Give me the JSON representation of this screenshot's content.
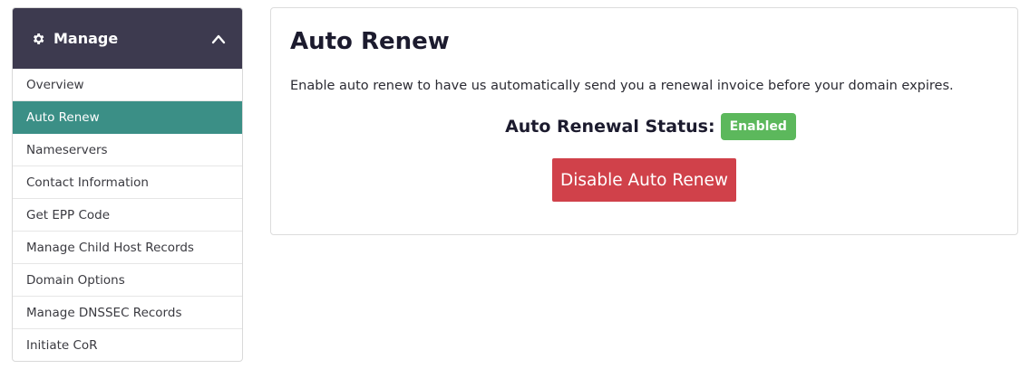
{
  "sidebar": {
    "header": {
      "title": "Manage",
      "icon": "gear-icon",
      "toggle_icon": "chevron-up-icon"
    },
    "items": [
      {
        "label": "Overview",
        "active": false
      },
      {
        "label": "Auto Renew",
        "active": true
      },
      {
        "label": "Nameservers",
        "active": false
      },
      {
        "label": "Contact Information",
        "active": false
      },
      {
        "label": "Get EPP Code",
        "active": false
      },
      {
        "label": "Manage Child Host Records",
        "active": false
      },
      {
        "label": "Domain Options",
        "active": false
      },
      {
        "label": "Manage DNSSEC Records",
        "active": false
      },
      {
        "label": "Initiate CoR",
        "active": false
      }
    ]
  },
  "main": {
    "title": "Auto Renew",
    "description": "Enable auto renew to have us automatically send you a renewal invoice before your domain expires.",
    "status_label": "Auto Renewal Status:",
    "status_value": "Enabled",
    "action_button": "Disable Auto Renew"
  },
  "colors": {
    "header_bg": "#3d3a4f",
    "active_item": "#3b8f86",
    "badge_success": "#5cb85c",
    "danger_button": "#d0414a"
  }
}
